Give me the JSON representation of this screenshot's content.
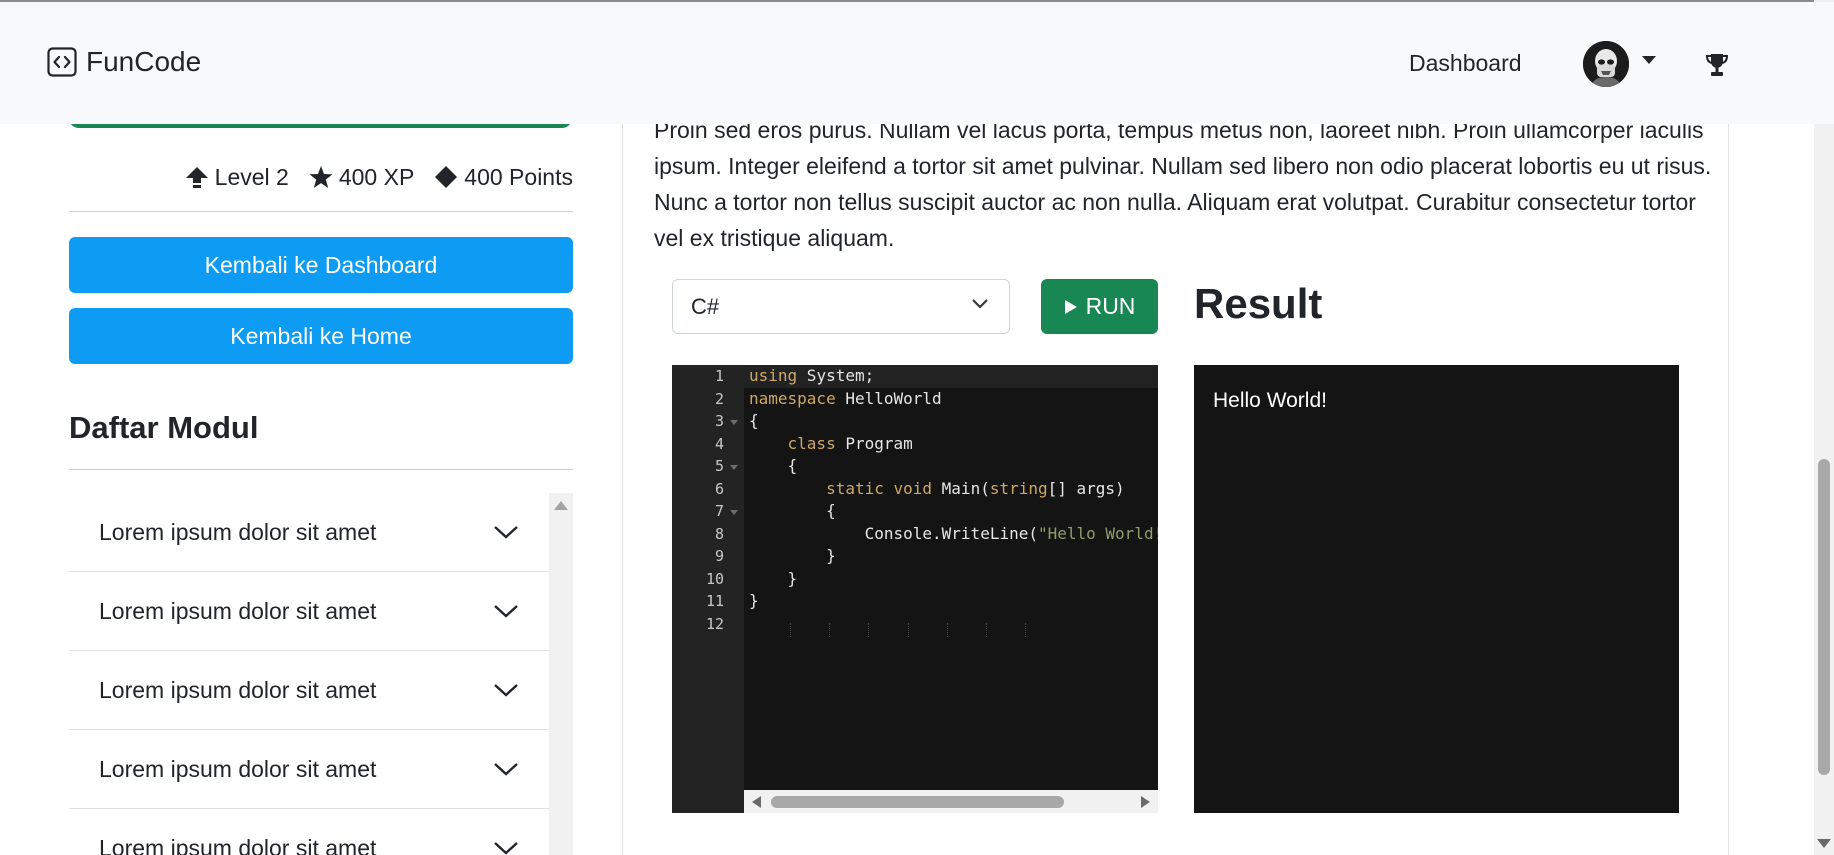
{
  "navbar": {
    "brand": "FunCode",
    "links": {
      "dashboard": "Dashboard"
    }
  },
  "sidebar": {
    "stats": {
      "level": "Level 2",
      "xp": "400 XP",
      "points": "400 Points"
    },
    "buttons": {
      "dashboard": "Kembali ke Dashboard",
      "home": "Kembali ke Home"
    },
    "modules_title": "Daftar Modul",
    "modules": [
      "Lorem ipsum dolor sit amet",
      "Lorem ipsum dolor sit amet",
      "Lorem ipsum dolor sit amet",
      "Lorem ipsum dolor sit amet",
      "Lorem ipsum dolor sit amet"
    ]
  },
  "lesson": {
    "text": "Proin sed eros purus. Nullam vel lacus porta, tempus metus non, laoreet nibh. Proin ullamcorper iaculis ipsum. Integer eleifend a tortor sit amet pulvinar. Nullam sed libero non odio placerat lobortis eu ut risus. Nunc a tortor non tellus suscipit auctor ac non nulla. Aliquam erat volutpat. Curabitur consectetur tortor vel ex tristique aliquam."
  },
  "editor": {
    "language": "C#",
    "run_label": "RUN",
    "line_numbers": [
      "1",
      "2",
      "3",
      "4",
      "5",
      "6",
      "7",
      "8",
      "9",
      "10",
      "11",
      "12"
    ]
  },
  "result": {
    "title": "Result",
    "output": "Hello World!"
  }
}
